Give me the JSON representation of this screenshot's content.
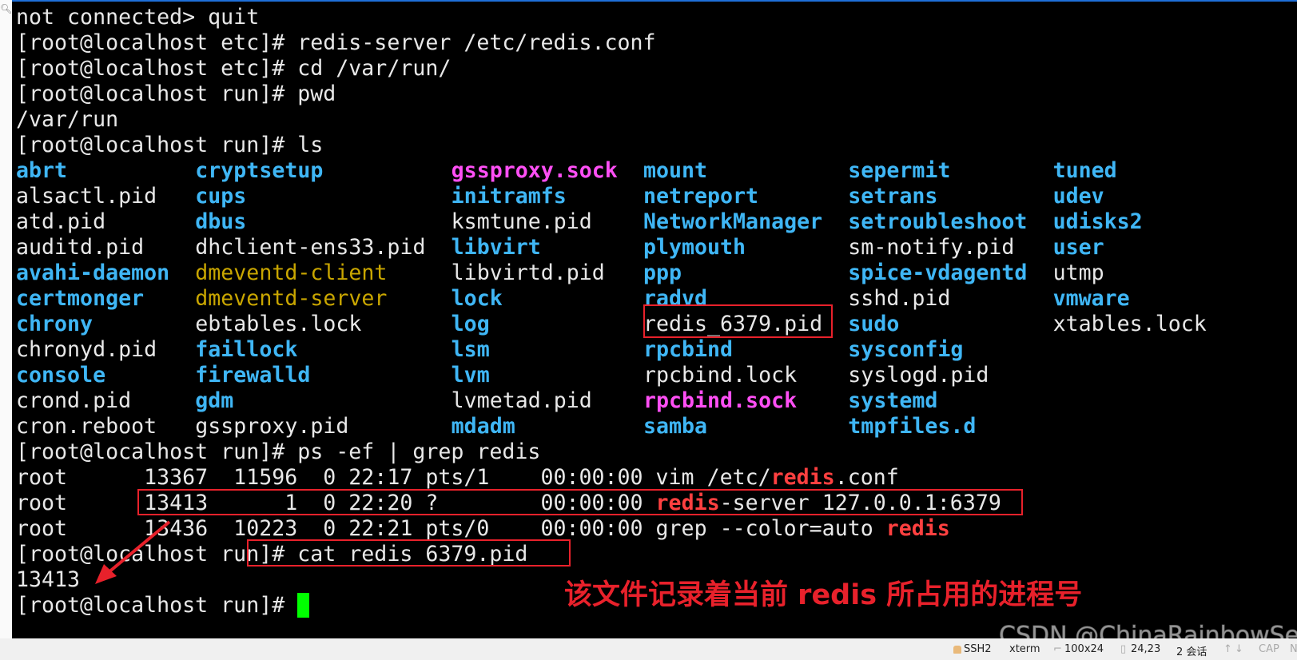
{
  "colors": {
    "background": "#000000",
    "text": "#e8e8e8",
    "directory": "#3fb6f5",
    "socket": "#ff4ff5",
    "pipe": "#c9a600",
    "grep_match": "#ff4040",
    "cursor": "#00ff00",
    "annotation": "#e8212b"
  },
  "terminal": {
    "lines": [
      {
        "segs": [
          {
            "text": "not connected> quit",
            "type": "plain"
          }
        ]
      },
      {
        "segs": [
          {
            "text": "[root@localhost etc]# redis-server /etc/redis.conf",
            "type": "plain"
          }
        ]
      },
      {
        "segs": [
          {
            "text": "[root@localhost etc]# cd /var/run/",
            "type": "plain"
          }
        ]
      },
      {
        "segs": [
          {
            "text": "[root@localhost run]# pwd",
            "type": "plain"
          }
        ]
      },
      {
        "segs": [
          {
            "text": "/var/run",
            "type": "plain"
          }
        ]
      },
      {
        "segs": [
          {
            "text": "[root@localhost run]# ls",
            "type": "plain"
          }
        ]
      }
    ],
    "ls_columns": [
      [
        {
          "name": "abrt",
          "type": "dir"
        },
        {
          "name": "alsactl.pid",
          "type": "file"
        },
        {
          "name": "atd.pid",
          "type": "file"
        },
        {
          "name": "auditd.pid",
          "type": "file"
        },
        {
          "name": "avahi-daemon",
          "type": "dir"
        },
        {
          "name": "certmonger",
          "type": "dir"
        },
        {
          "name": "chrony",
          "type": "dir"
        },
        {
          "name": "chronyd.pid",
          "type": "file"
        },
        {
          "name": "console",
          "type": "dir"
        },
        {
          "name": "crond.pid",
          "type": "file"
        },
        {
          "name": "cron.reboot",
          "type": "file"
        }
      ],
      [
        {
          "name": "cryptsetup",
          "type": "dir"
        },
        {
          "name": "cups",
          "type": "dir"
        },
        {
          "name": "dbus",
          "type": "dir"
        },
        {
          "name": "dhclient-ens33.pid",
          "type": "file"
        },
        {
          "name": "dmeventd-client",
          "type": "pipe"
        },
        {
          "name": "dmeventd-server",
          "type": "pipe"
        },
        {
          "name": "ebtables.lock",
          "type": "file"
        },
        {
          "name": "faillock",
          "type": "dir"
        },
        {
          "name": "firewalld",
          "type": "dir"
        },
        {
          "name": "gdm",
          "type": "dir"
        },
        {
          "name": "gssproxy.pid",
          "type": "file"
        }
      ],
      [
        {
          "name": "gssproxy.sock",
          "type": "sock"
        },
        {
          "name": "initramfs",
          "type": "dir"
        },
        {
          "name": "ksmtune.pid",
          "type": "file"
        },
        {
          "name": "libvirt",
          "type": "dir"
        },
        {
          "name": "libvirtd.pid",
          "type": "file"
        },
        {
          "name": "lock",
          "type": "dir"
        },
        {
          "name": "log",
          "type": "dir"
        },
        {
          "name": "lsm",
          "type": "dir"
        },
        {
          "name": "lvm",
          "type": "dir"
        },
        {
          "name": "lvmetad.pid",
          "type": "file"
        },
        {
          "name": "mdadm",
          "type": "dir"
        }
      ],
      [
        {
          "name": "mount",
          "type": "dir"
        },
        {
          "name": "netreport",
          "type": "dir"
        },
        {
          "name": "NetworkManager",
          "type": "dir"
        },
        {
          "name": "plymouth",
          "type": "dir"
        },
        {
          "name": "ppp",
          "type": "dir"
        },
        {
          "name": "radvd",
          "type": "dir"
        },
        {
          "name": "redis_6379.pid",
          "type": "file"
        },
        {
          "name": "rpcbind",
          "type": "dir"
        },
        {
          "name": "rpcbind.lock",
          "type": "file"
        },
        {
          "name": "rpcbind.sock",
          "type": "sock"
        },
        {
          "name": "samba",
          "type": "dir"
        }
      ],
      [
        {
          "name": "sepermit",
          "type": "dir"
        },
        {
          "name": "setrans",
          "type": "dir"
        },
        {
          "name": "setroubleshoot",
          "type": "dir"
        },
        {
          "name": "sm-notify.pid",
          "type": "file"
        },
        {
          "name": "spice-vdagentd",
          "type": "dir"
        },
        {
          "name": "sshd.pid",
          "type": "file"
        },
        {
          "name": "sudo",
          "type": "dir"
        },
        {
          "name": "sysconfig",
          "type": "dir"
        },
        {
          "name": "syslogd.pid",
          "type": "file"
        },
        {
          "name": "systemd",
          "type": "dir"
        },
        {
          "name": "tmpfiles.d",
          "type": "dir"
        }
      ],
      [
        {
          "name": "tuned",
          "type": "dir"
        },
        {
          "name": "udev",
          "type": "dir"
        },
        {
          "name": "udisks2",
          "type": "dir"
        },
        {
          "name": "user",
          "type": "dir"
        },
        {
          "name": "utmp",
          "type": "file"
        },
        {
          "name": "vmware",
          "type": "dir"
        },
        {
          "name": "xtables.lock",
          "type": "file"
        }
      ]
    ],
    "lines_after": [
      {
        "segs": [
          {
            "text": "[root@localhost run]# ps -ef | grep redis",
            "type": "plain"
          }
        ]
      },
      {
        "segs": [
          {
            "text": "root      13367  11596  0 22:17 pts/1    00:00:00 vim /etc/",
            "type": "plain"
          },
          {
            "text": "redis",
            "type": "match"
          },
          {
            "text": ".conf",
            "type": "plain"
          }
        ]
      },
      {
        "segs": [
          {
            "text": "root      13413      1  0 22:20 ?        00:00:00 ",
            "type": "plain"
          },
          {
            "text": "redis",
            "type": "match"
          },
          {
            "text": "-server 127.0.0.1:6379",
            "type": "plain"
          }
        ]
      },
      {
        "segs": [
          {
            "text": "root      13436  10223  0 22:21 pts/0    00:00:00 grep --color=auto ",
            "type": "plain"
          },
          {
            "text": "redis",
            "type": "match"
          }
        ]
      },
      {
        "segs": [
          {
            "text": "[root@localhost run]# cat redis_6379.pid",
            "type": "plain"
          }
        ]
      },
      {
        "segs": [
          {
            "text": "13413",
            "type": "plain"
          }
        ]
      },
      {
        "segs": [
          {
            "text": "[root@localhost run]# ",
            "type": "plain"
          }
        ],
        "cursor": true
      }
    ]
  },
  "annotation": {
    "text": "该文件记录着当前 redis 所占用的进程号"
  },
  "watermark": "CSDN @ChinaRainbowSea",
  "statusbar": {
    "protocol": "SSH2",
    "term_type": "xterm",
    "size": "100x24",
    "cursor_pos": "24,23",
    "sessions": "2 会话",
    "caps": "CAP",
    "num": "N"
  }
}
